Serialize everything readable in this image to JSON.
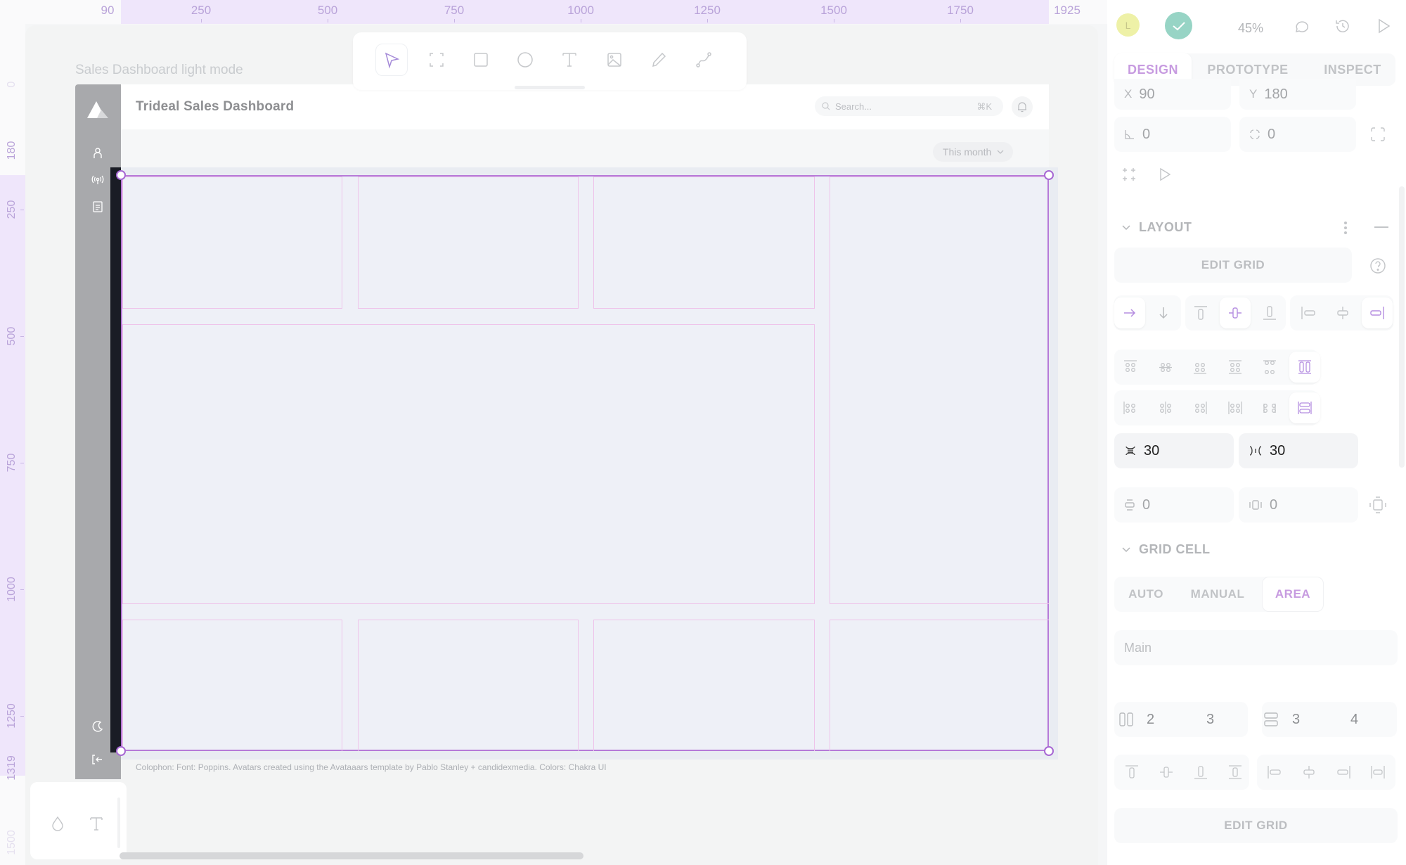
{
  "rulers": {
    "top_labels": [
      "90",
      "250",
      "500",
      "750",
      "1000",
      "1250",
      "1500",
      "1750",
      "1925"
    ],
    "left_labels": [
      "0",
      "180",
      "250",
      "500",
      "750",
      "1000",
      "1250",
      "1319",
      "1500"
    ]
  },
  "canvas": {
    "frame_name": "Sales Dashboard light mode"
  },
  "toolbar": {
    "tools": [
      {
        "name": "move",
        "icon": "cursor-arrow-icon",
        "active": true
      },
      {
        "name": "board",
        "icon": "frame-icon",
        "active": false
      },
      {
        "name": "rectangle",
        "icon": "rectangle-icon",
        "active": false
      },
      {
        "name": "ellipse",
        "icon": "ellipse-icon",
        "active": false
      },
      {
        "name": "text",
        "icon": "text-icon",
        "active": false
      },
      {
        "name": "image",
        "icon": "image-icon",
        "active": false
      },
      {
        "name": "pencil",
        "icon": "pencil-icon",
        "active": false
      },
      {
        "name": "path",
        "icon": "path-icon",
        "active": false
      }
    ]
  },
  "dashboard": {
    "title": "Trideal Sales Dashboard",
    "search_placeholder": "Search...",
    "search_shortcut": "⌘K",
    "date_range": "This month",
    "colophon": "Colophon: Font: Poppins. Avatars created using the Avataaars template by Pablo Stanley + candidexmedia. Colors: Chakra UI",
    "sidebar_icons": [
      "user-icon",
      "broadcast-icon",
      "document-icon",
      "moon-icon",
      "logout-icon"
    ]
  },
  "mini_panel": {
    "icons": [
      "fill-drop-icon",
      "text-icon"
    ]
  },
  "right_panel": {
    "avatar_initial": "L",
    "zoom": "45%",
    "tabs": [
      "DESIGN",
      "PROTOTYPE",
      "INSPECT"
    ],
    "active_tab": "DESIGN",
    "position": {
      "x_label": "X",
      "x": "90",
      "y_label": "Y",
      "y": "180"
    },
    "rotation": "0",
    "radius": "0",
    "layout": {
      "title": "LAYOUT",
      "edit_grid": "EDIT GRID",
      "row_gap": "30",
      "column_gap": "30",
      "padding_vertical": "0",
      "padding_horizontal": "0"
    },
    "grid_cell": {
      "title": "GRID CELL",
      "modes": [
        "AUTO",
        "MANUAL",
        "AREA"
      ],
      "active_mode": "AREA",
      "area_name": "Main",
      "column_start": "2",
      "column_end": "3",
      "row_start": "3",
      "row_end": "4",
      "edit_grid": "EDIT GRID"
    }
  },
  "colors": {
    "accent": "#b67ad8",
    "grid_cell_line": "#eec3ea",
    "ruler_band": "#efe6fb",
    "sync_ok": "#97d4c5",
    "avatar_bg": "#eef1a7"
  }
}
